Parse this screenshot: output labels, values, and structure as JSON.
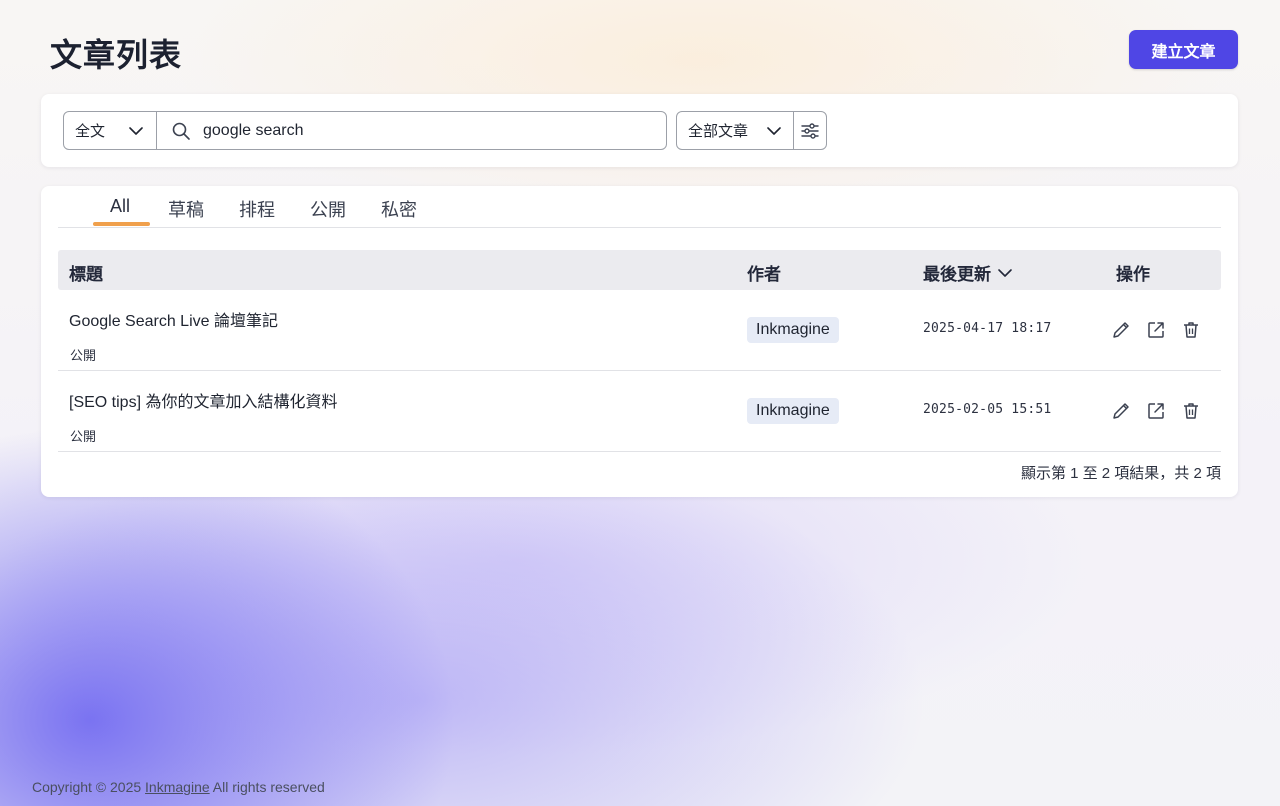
{
  "header": {
    "title": "文章列表",
    "create_button_label": "建立文章"
  },
  "filters": {
    "scope_select_value": "全文",
    "search_value": "google search",
    "type_select_value": "全部文章"
  },
  "tabs": [
    {
      "label": "All",
      "active": true
    },
    {
      "label": "草稿",
      "active": false
    },
    {
      "label": "排程",
      "active": false
    },
    {
      "label": "公開",
      "active": false
    },
    {
      "label": "私密",
      "active": false
    }
  ],
  "table": {
    "columns": {
      "title": "標題",
      "author": "作者",
      "updated": "最後更新",
      "actions": "操作"
    },
    "rows": [
      {
        "title": "Google Search Live 論壇筆記",
        "status": "公開",
        "author": "Inkmagine",
        "updated": "2025-04-17 18:17"
      },
      {
        "title": "[SEO tips] 為你的文章加入結構化資料",
        "status": "公開",
        "author": "Inkmagine",
        "updated": "2025-02-05 15:51"
      }
    ]
  },
  "pagination": {
    "summary": "顯示第 1 至 2 項結果，共 2 項"
  },
  "footer": {
    "prefix": "Copyright © 2025 ",
    "link": "Inkmagine",
    "suffix": " All rights reserved"
  },
  "colors": {
    "accent": "#4f46e5",
    "tab_underline": "#f0a04c",
    "badge_bg": "#e6ebf6",
    "header_bg": "#ebebef"
  },
  "icons": {
    "search": "search-icon",
    "chevron": "chevron-down-icon",
    "filter": "sliders-icon",
    "edit": "pencil-icon",
    "open": "external-link-icon",
    "delete": "trash-icon"
  }
}
